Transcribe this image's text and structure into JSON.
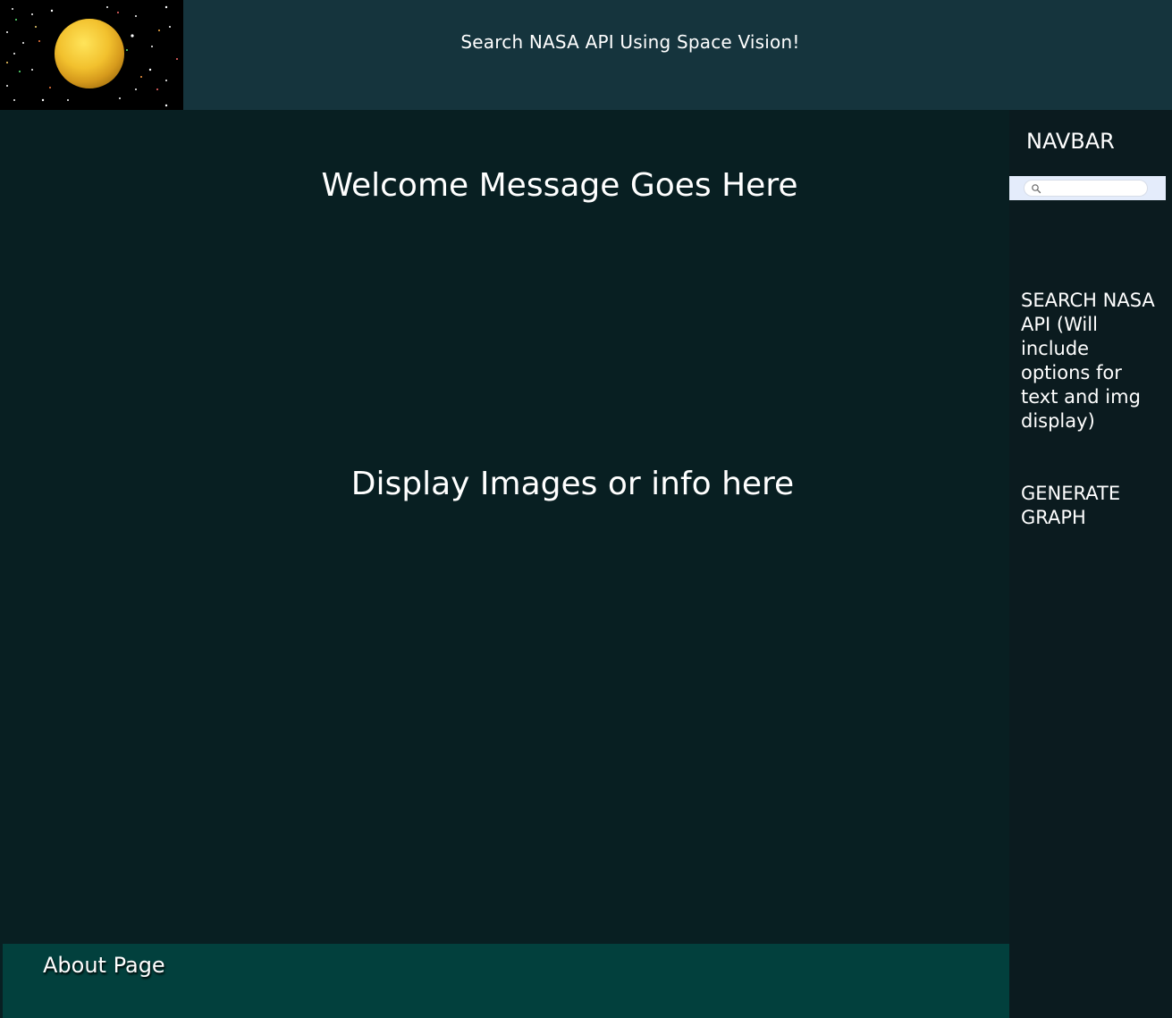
{
  "header": {
    "title": "Search NASA API Using Space Vision!",
    "logo_icon": "planet-starfield-icon"
  },
  "main": {
    "welcome": "Welcome Message Goes Here",
    "display_placeholder": "Display Images or info here"
  },
  "sidebar": {
    "title": "NAVBAR",
    "search": {
      "placeholder": "",
      "value": "",
      "icon": "search-icon"
    },
    "links": [
      {
        "label": "SEARCH NASA API (Will include options for text and img display)"
      },
      {
        "label": "GENERATE GRAPH"
      }
    ]
  },
  "footer": {
    "about_label": "About Page"
  },
  "colors": {
    "header_bg": "#15343d",
    "main_bg": "#081f22",
    "sidebar_bg": "#0b1b1f",
    "footer_bg": "#02403d",
    "search_strip_bg": "#e4ecfb",
    "planet": "#f2c12e"
  }
}
